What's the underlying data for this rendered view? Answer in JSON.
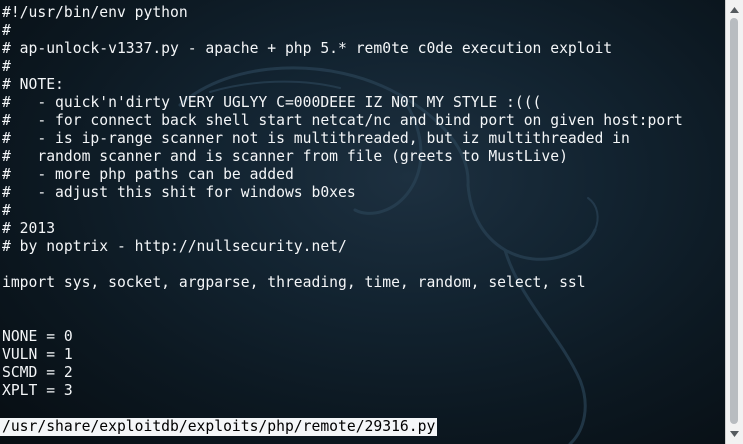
{
  "file_lines": [
    "#!/usr/bin/env python",
    "#",
    "# ap-unlock-v1337.py - apache + php 5.* rem0te c0de execution exploit",
    "#",
    "# NOTE:",
    "#   - quick'n'dirty VERY UGLYY C=000DEEE IZ N0T MY STYLE :(((",
    "#   - for connect back shell start netcat/nc and bind port on given host:port",
    "#   - is ip-range scanner not is multithreaded, but iz multithreaded in",
    "#   random scanner and is scanner from file (greets to MustLive)",
    "#   - more php paths can be added",
    "#   - adjust this shit for windows b0xes",
    "#",
    "# 2013",
    "# by noptrix - http://nullsecurity.net/",
    "",
    "import sys, socket, argparse, threading, time, random, select, ssl",
    "",
    "",
    "NONE = 0",
    "VULN = 1",
    "SCMD = 2",
    "XPLT = 3",
    ""
  ],
  "status_bar": {
    "filename": "/usr/share/exploitdb/exploits/php/remote/29316.py"
  },
  "scrollbar": {
    "up_icon": "arrow-up-icon",
    "down_icon": "arrow-down-icon"
  },
  "colors": {
    "text": "#f4f6f8",
    "background": "#0c1821",
    "status_background": "#f4f6f8",
    "status_text": "#000000"
  }
}
